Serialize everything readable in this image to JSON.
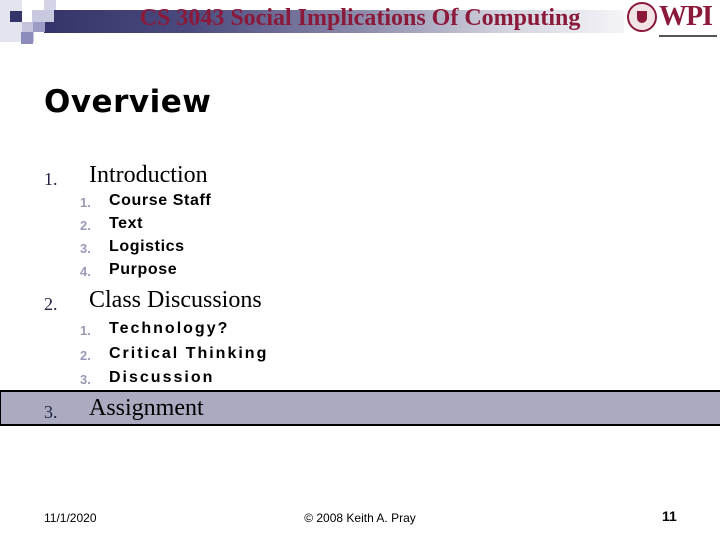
{
  "header": {
    "title": "CS 3043 Social Implications Of Computing",
    "logo_text": "WPI",
    "logo_icon": "wpi-seal-icon",
    "colors": {
      "title": "#8b1a3a",
      "band_dark": "#34346a",
      "highlight": "#aaaac0"
    }
  },
  "slide": {
    "title": "Overview",
    "outline": [
      {
        "number": "1.",
        "label": "Introduction",
        "items": [
          {
            "number": "1.",
            "label": "Course Staff"
          },
          {
            "number": "2.",
            "label": "Text"
          },
          {
            "number": "3.",
            "label": "Logistics"
          },
          {
            "number": "4.",
            "label": "Purpose"
          }
        ]
      },
      {
        "number": "2.",
        "label": "Class Discussions",
        "items": [
          {
            "number": "1.",
            "label": "Technology?"
          },
          {
            "number": "2.",
            "label": "Critical Thinking"
          },
          {
            "number": "3.",
            "label": "Discussion"
          }
        ]
      },
      {
        "number": "3.",
        "label": "Assignment",
        "highlighted": true,
        "items": []
      }
    ]
  },
  "footer": {
    "date": "11/1/2020",
    "copyright": "© 2008 Keith A. Pray",
    "page_number": "11"
  }
}
